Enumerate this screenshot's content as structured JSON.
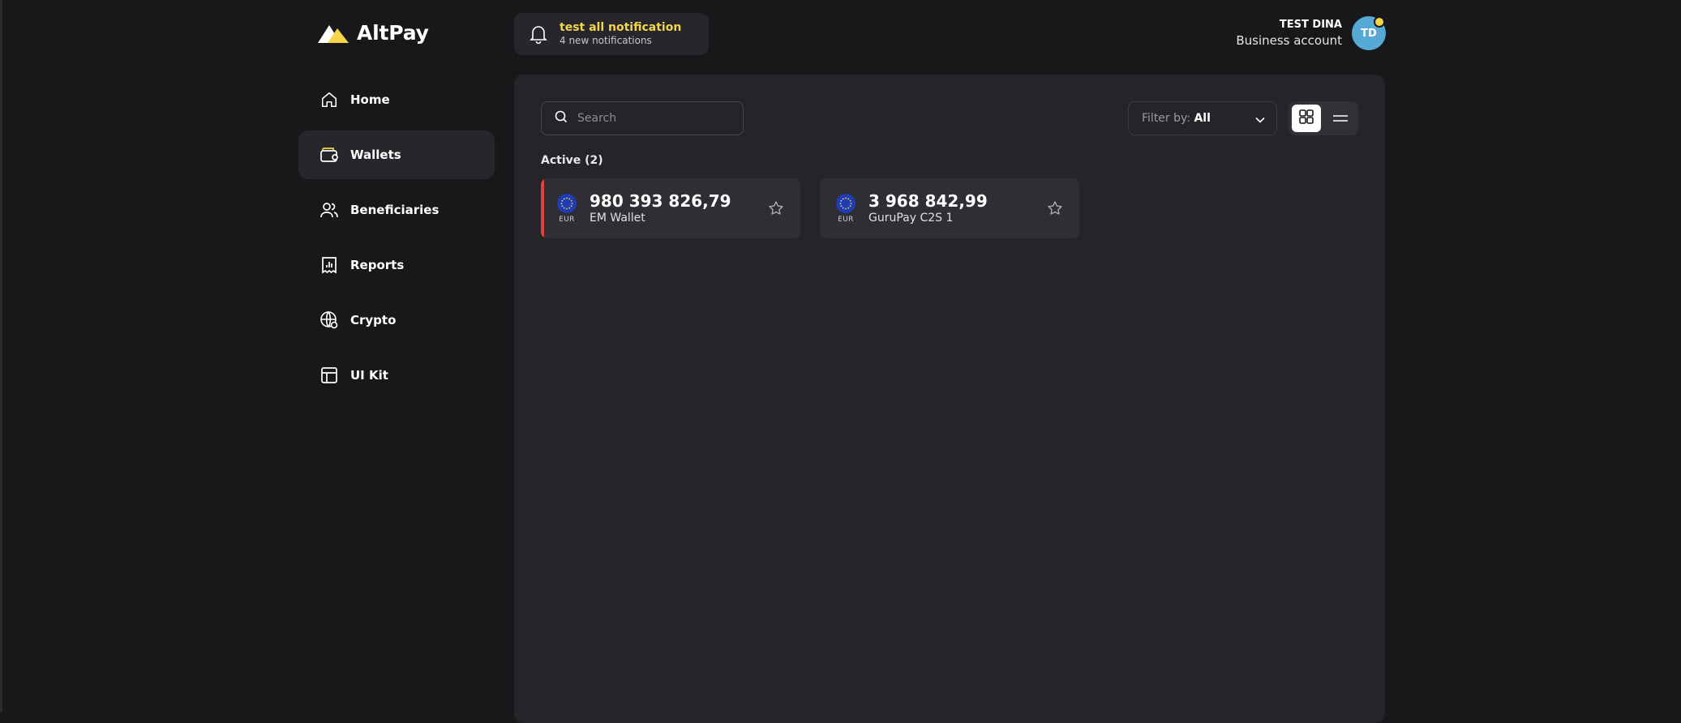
{
  "brand": {
    "name": "AltPay",
    "logo_color": "#f5d64a"
  },
  "sidebar": {
    "items": [
      {
        "label": "Home",
        "icon": "home-icon",
        "active": false
      },
      {
        "label": "Wallets",
        "icon": "wallet-icon",
        "active": true
      },
      {
        "label": "Beneficiaries",
        "icon": "users-icon",
        "active": false
      },
      {
        "label": "Reports",
        "icon": "reports-icon",
        "active": false
      },
      {
        "label": "Crypto",
        "icon": "globe-icon",
        "active": false
      },
      {
        "label": "UI Kit",
        "icon": "layout-icon",
        "active": false
      }
    ]
  },
  "notification": {
    "title": "test all notification",
    "subtitle": "4 new notifications",
    "title_color": "#f5d64a"
  },
  "user": {
    "name": "TEST DINA",
    "account_type": "Business account",
    "initials": "TD",
    "avatar_color": "#56a8d5",
    "status_dot_color": "#f5d64a"
  },
  "toolbar": {
    "search_placeholder": "Search",
    "filter_label": "Filter by:",
    "filter_value": "All"
  },
  "wallets_section": {
    "label": "Active (2)",
    "items": [
      {
        "amount": "980 393 826,79",
        "name": "EM Wallet",
        "currency": "EUR",
        "accent_color": "#e0413b"
      },
      {
        "amount": "3 968 842,99",
        "name": "GuruPay C2S 1",
        "currency": "EUR"
      }
    ]
  }
}
